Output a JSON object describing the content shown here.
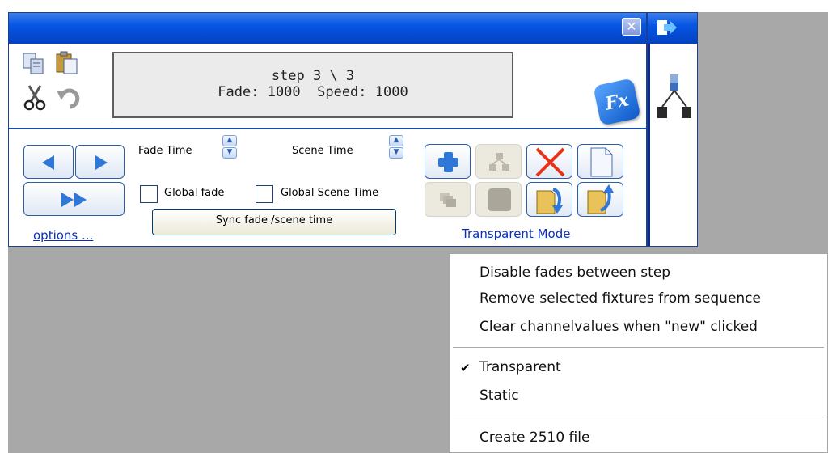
{
  "display": {
    "line1": "step 3 \\ 3",
    "line2": "Fade: 1000  Speed: 1000"
  },
  "fx_label": "Fx",
  "close_label": "✕",
  "labels": {
    "fade_time": "Fade Time",
    "scene_time": "Scene Time",
    "global_fade": "Global fade",
    "global_scene_time": "Global Scene Time",
    "sync_button": "Sync fade /scene time",
    "options_link": "options ...",
    "transparent_mode_link": "Transparent Mode"
  },
  "menu": {
    "items": [
      "Disable fades between step",
      "Remove selected fixtures from sequence",
      "Clear channelvalues when \"new\" clicked",
      "Transparent",
      "Static",
      "Create 2510 file"
    ],
    "checked_index": 3,
    "check_symbol": "✔"
  },
  "colors": {
    "titlebar": "#0656e5",
    "accent_blue": "#2f78d8",
    "delete_red": "#e8321a",
    "link": "#0b2fb8"
  }
}
